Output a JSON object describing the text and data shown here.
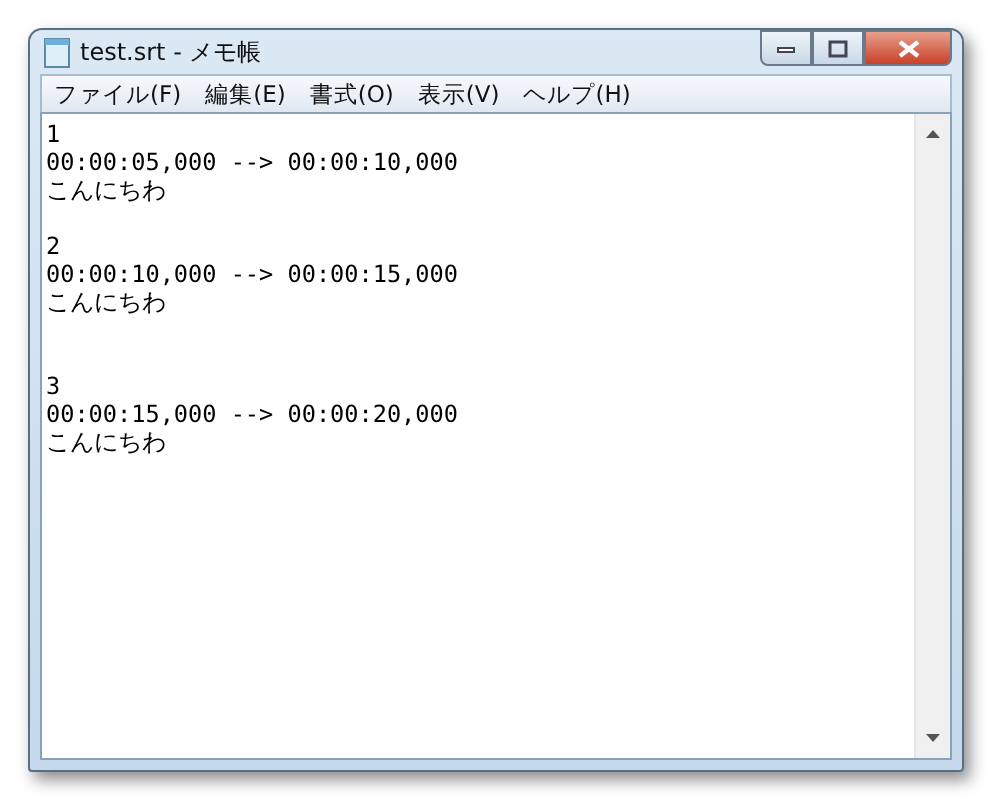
{
  "window": {
    "title": "test.srt - メモ帳"
  },
  "menu": [
    "ファイル(F)",
    "編集(E)",
    "書式(O)",
    "表示(V)",
    "ヘルプ(H)"
  ],
  "editor": {
    "text": "1\n00:00:05,000 --> 00:00:10,000\nこんにちわ\n\n2\n00:00:10,000 --> 00:00:15,000\nこんにちわ\n\n\n3\n00:00:15,000 --> 00:00:20,000\nこんにちわ"
  }
}
